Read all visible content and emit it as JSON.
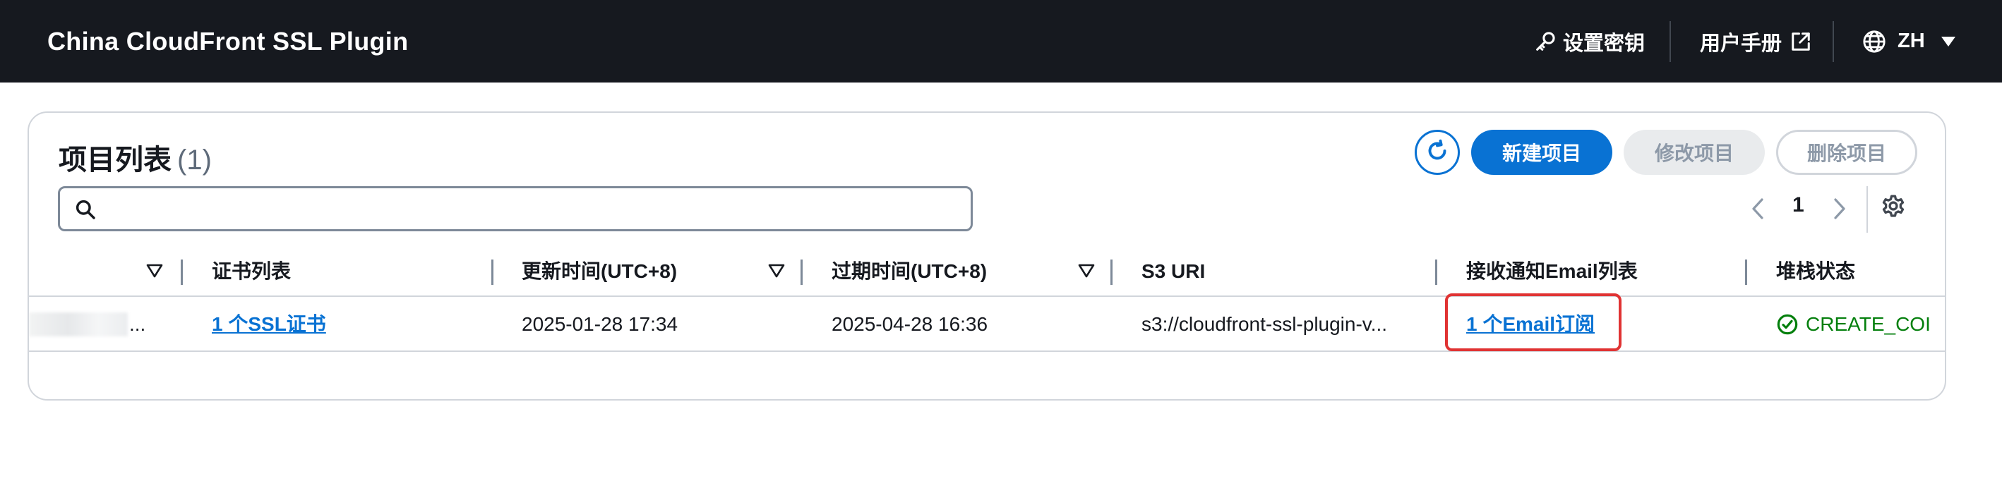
{
  "app": {
    "title": "China CloudFront SSL Plugin"
  },
  "nav": {
    "set_key_label": "设置密钥",
    "user_manual_label": "用户手册",
    "language_label": "ZH"
  },
  "card": {
    "heading": "项目列表",
    "count": "(1)",
    "refresh_icon": "refresh-icon",
    "buttons": {
      "new_project": "新建项目",
      "edit_project": "修改项目",
      "delete_project": "删除项目"
    },
    "search": {
      "value": "",
      "placeholder": ""
    },
    "pagination": {
      "current_page": "1"
    }
  },
  "table": {
    "columns": [
      "证书列表",
      "更新时间(UTC+8)",
      "过期时间(UTC+8)",
      "S3 URI",
      "接收通知Email列表",
      "堆栈状态"
    ],
    "rows": [
      {
        "name_suffix": "...",
        "certificates": "1 个SSL证书",
        "updated_at": "2025-01-28 17:34",
        "expires_at": "2025-04-28 16:36",
        "s3_uri": "s3://cloudfront-ssl-plugin-v...",
        "email_subscriptions": "1 个Email订阅",
        "stack_status": "CREATE_COI"
      }
    ]
  },
  "colors": {
    "nav_bg": "#16191f",
    "accent": "#0972d3",
    "success": "#037f0c",
    "highlight": "#e03333"
  }
}
